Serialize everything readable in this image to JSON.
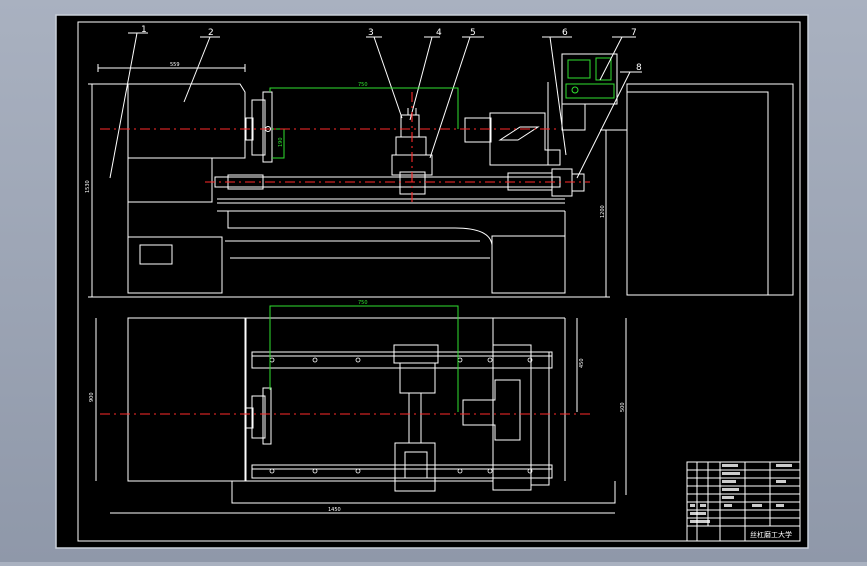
{
  "drawing": {
    "part_labels": [
      "1",
      "2",
      "3",
      "4",
      "5",
      "6",
      "7",
      "8"
    ],
    "dimensions": {
      "front_width_559": "559",
      "front_travel_750": "750",
      "front_height_1530": "1530",
      "front_height_1200": "1200",
      "front_small_190": "190",
      "plan_travel_750": "750",
      "plan_depth_900": "900",
      "plan_depth_450": "450",
      "plan_depth_500": "500",
      "plan_length_1450": "1450"
    },
    "title_block": {
      "title": "丝杠磨工大学"
    },
    "colors": {
      "outline": "#ffffff",
      "dimension": "#2fe02f",
      "centerline": "#ff2a2a",
      "background": "#000000"
    }
  }
}
